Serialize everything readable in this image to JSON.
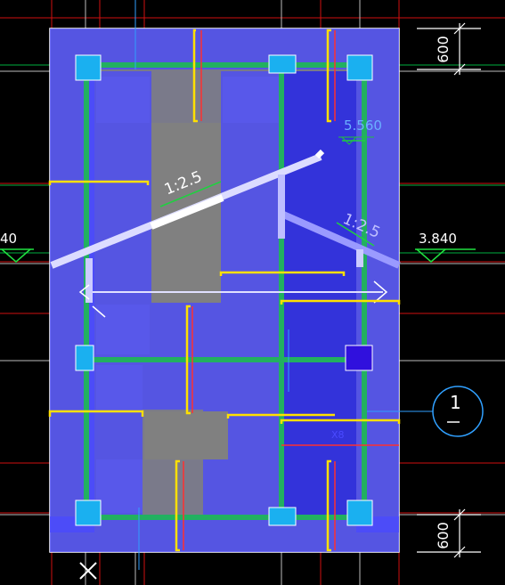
{
  "labels": {
    "dim_top": "600",
    "dim_bottom": "600",
    "elev_upper": "5.560",
    "elev_right": "3.840",
    "elev_left": "40",
    "slope_left": "1:2.5",
    "slope_right": "1:2.5",
    "axis_mark": "1",
    "beam_x8": "X8"
  },
  "colors": {
    "background": "#000000",
    "slab_fill": "#4040ff",
    "column_fill": "#00c0ff",
    "column_dark": "#2020cc",
    "beam_green": "#22aa55",
    "rebar_yellow": "#ffe000",
    "grid_red": "#e01010",
    "grid_white": "#c8c8c8",
    "grid_green": "#00c040",
    "dim_white": "#ffffff",
    "cyan_text": "#40a0ff"
  }
}
